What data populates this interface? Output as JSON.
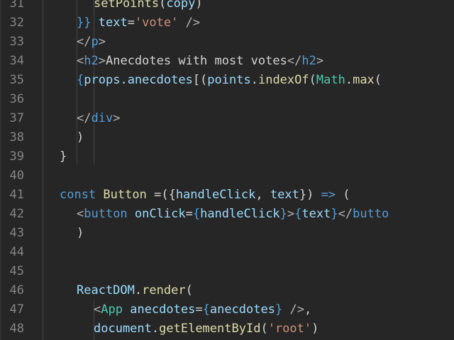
{
  "editor": {
    "lines": [
      {
        "num": "31",
        "indent": 3,
        "tokens": [
          {
            "t": "setPoints",
            "c": "func"
          },
          {
            "t": "(",
            "c": "plain"
          },
          {
            "t": "copy",
            "c": "var"
          },
          {
            "t": ")",
            "c": "plain"
          }
        ]
      },
      {
        "num": "32",
        "indent": 2,
        "tokens": [
          {
            "t": "}",
            "c": "brace"
          },
          {
            "t": "} ",
            "c": "brace"
          },
          {
            "t": "text",
            "c": "attr"
          },
          {
            "t": "=",
            "c": "plain"
          },
          {
            "t": "'vote'",
            "c": "str"
          },
          {
            "t": " />",
            "c": "punct"
          }
        ]
      },
      {
        "num": "33",
        "indent": 2,
        "tokens": [
          {
            "t": "</",
            "c": "punct"
          },
          {
            "t": "p",
            "c": "tag"
          },
          {
            "t": ">",
            "c": "punct"
          }
        ]
      },
      {
        "num": "34",
        "indent": 2,
        "tokens": [
          {
            "t": "<",
            "c": "punct"
          },
          {
            "t": "h2",
            "c": "tag"
          },
          {
            "t": ">",
            "c": "punct"
          },
          {
            "t": "Anecdotes with most votes",
            "c": "plain"
          },
          {
            "t": "</",
            "c": "punct"
          },
          {
            "t": "h2",
            "c": "tag"
          },
          {
            "t": ">",
            "c": "punct"
          }
        ]
      },
      {
        "num": "35",
        "indent": 2,
        "tokens": [
          {
            "t": "{",
            "c": "brace"
          },
          {
            "t": "props",
            "c": "var"
          },
          {
            "t": ".",
            "c": "plain"
          },
          {
            "t": "anecdotes",
            "c": "var"
          },
          {
            "t": "[(",
            "c": "plain"
          },
          {
            "t": "points",
            "c": "var"
          },
          {
            "t": ".",
            "c": "plain"
          },
          {
            "t": "indexOf",
            "c": "func"
          },
          {
            "t": "(",
            "c": "plain"
          },
          {
            "t": "Math",
            "c": "class"
          },
          {
            "t": ".",
            "c": "plain"
          },
          {
            "t": "max",
            "c": "func"
          },
          {
            "t": "(",
            "c": "plain"
          }
        ]
      },
      {
        "num": "36",
        "indent": 2,
        "tokens": []
      },
      {
        "num": "37",
        "indent": 2,
        "tokens": [
          {
            "t": "</",
            "c": "punct"
          },
          {
            "t": "div",
            "c": "tag"
          },
          {
            "t": ">",
            "c": "punct"
          }
        ]
      },
      {
        "num": "38",
        "indent": 2,
        "tokens": [
          {
            "t": ")",
            "c": "plain"
          }
        ]
      },
      {
        "num": "39",
        "indent": 1,
        "tokens": [
          {
            "t": "}",
            "c": "plain"
          }
        ]
      },
      {
        "num": "40",
        "indent": 1,
        "tokens": []
      },
      {
        "num": "41",
        "indent": 1,
        "tokens": [
          {
            "t": "const ",
            "c": "kw"
          },
          {
            "t": "Button",
            "c": "func"
          },
          {
            "t": " =(",
            "c": "plain"
          },
          {
            "t": "{",
            "c": "plain"
          },
          {
            "t": "handleClick",
            "c": "var"
          },
          {
            "t": ", ",
            "c": "plain"
          },
          {
            "t": "text",
            "c": "var"
          },
          {
            "t": "}) ",
            "c": "plain"
          },
          {
            "t": "=>",
            "c": "kw"
          },
          {
            "t": " (",
            "c": "plain"
          }
        ]
      },
      {
        "num": "42",
        "indent": 2,
        "tokens": [
          {
            "t": "<",
            "c": "punct"
          },
          {
            "t": "button",
            "c": "tag"
          },
          {
            "t": " ",
            "c": "plain"
          },
          {
            "t": "onClick",
            "c": "attr"
          },
          {
            "t": "=",
            "c": "plain"
          },
          {
            "t": "{",
            "c": "brace"
          },
          {
            "t": "handleClick",
            "c": "var"
          },
          {
            "t": "}",
            "c": "brace"
          },
          {
            "t": ">",
            "c": "punct"
          },
          {
            "t": "{",
            "c": "brace"
          },
          {
            "t": "text",
            "c": "var"
          },
          {
            "t": "}",
            "c": "brace"
          },
          {
            "t": "</",
            "c": "punct"
          },
          {
            "t": "butto",
            "c": "tag"
          }
        ]
      },
      {
        "num": "43",
        "indent": 2,
        "tokens": [
          {
            "t": ")",
            "c": "plain"
          }
        ]
      },
      {
        "num": "44",
        "indent": 1,
        "tokens": []
      },
      {
        "num": "45",
        "indent": 1,
        "tokens": []
      },
      {
        "num": "46",
        "indent": 2,
        "tokens": [
          {
            "t": "ReactDOM",
            "c": "var"
          },
          {
            "t": ".",
            "c": "plain"
          },
          {
            "t": "render",
            "c": "func"
          },
          {
            "t": "(",
            "c": "plain"
          }
        ]
      },
      {
        "num": "47",
        "indent": 3,
        "tokens": [
          {
            "t": "<",
            "c": "punct"
          },
          {
            "t": "App",
            "c": "class"
          },
          {
            "t": " ",
            "c": "plain"
          },
          {
            "t": "anecdotes",
            "c": "attr"
          },
          {
            "t": "=",
            "c": "plain"
          },
          {
            "t": "{",
            "c": "brace"
          },
          {
            "t": "anecdotes",
            "c": "var"
          },
          {
            "t": "}",
            "c": "brace"
          },
          {
            "t": " />",
            "c": "punct"
          },
          {
            "t": ",",
            "c": "plain"
          }
        ]
      },
      {
        "num": "48",
        "indent": 3,
        "tokens": [
          {
            "t": "document",
            "c": "var"
          },
          {
            "t": ".",
            "c": "plain"
          },
          {
            "t": "getElementById",
            "c": "func"
          },
          {
            "t": "(",
            "c": "plain"
          },
          {
            "t": "'root'",
            "c": "str"
          },
          {
            "t": ")",
            "c": "plain"
          }
        ]
      }
    ]
  }
}
